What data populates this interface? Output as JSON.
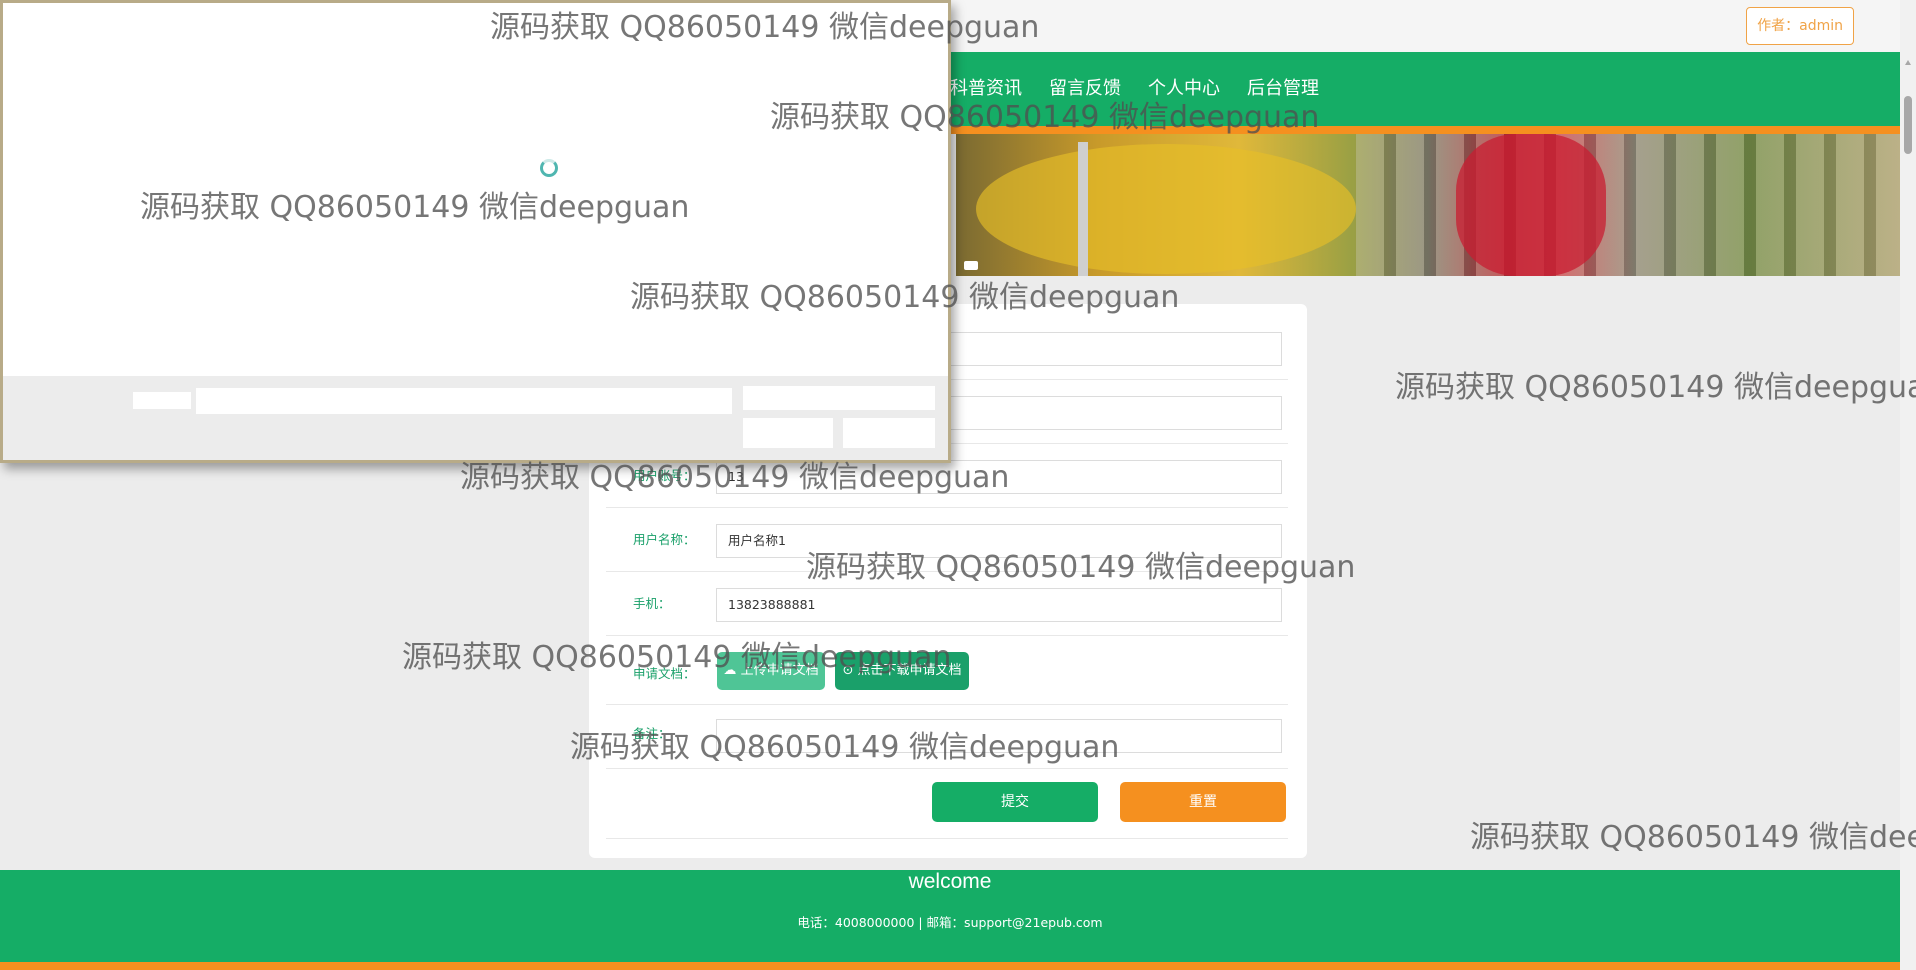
{
  "header": {
    "author_badge": "作者：admin"
  },
  "nav": {
    "items": [
      "科普资讯",
      "留言反馈",
      "个人中心",
      "后台管理"
    ]
  },
  "form": {
    "fields": [
      {
        "label": "",
        "value": ""
      },
      {
        "label": "",
        "value": ""
      },
      {
        "label": "用户账号：",
        "value": "13"
      },
      {
        "label": "用户名称：",
        "value": "用户名称1"
      },
      {
        "label": "手机：",
        "value": "13823888881"
      }
    ],
    "document_label": "申请文档：",
    "upload_button": "上传申请文档",
    "download_button": "点击下载申请文档",
    "remark_label": "备注：",
    "remark_value": "",
    "submit_button": "提交",
    "reset_button": "重置"
  },
  "footer": {
    "title": "welcome",
    "contact": "电话：4008000000 | 邮箱：support@21epub.com"
  },
  "watermark_text": "源码获取 QQ86050149 微信deepguan",
  "colors": {
    "primary": "#15ad66",
    "accent": "#f5901f"
  }
}
